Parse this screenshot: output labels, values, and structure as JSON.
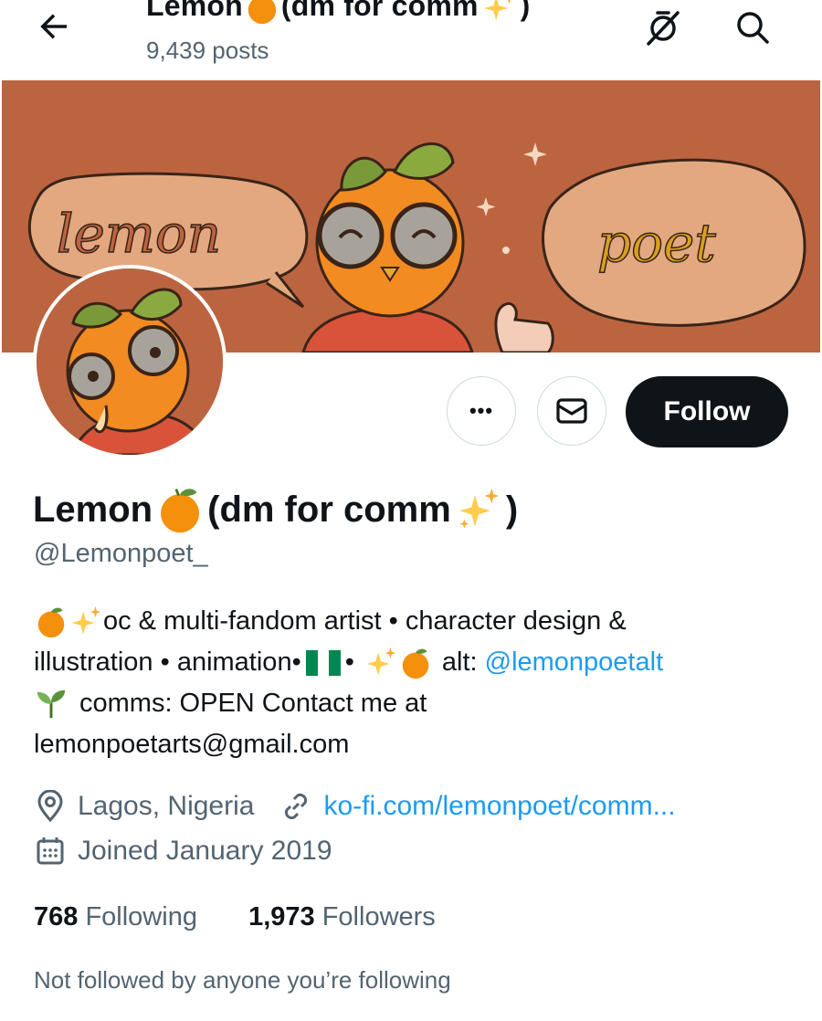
{
  "header": {
    "title_prefix": "Lemon",
    "title_suffix": "(dm for comm",
    "title_close": ")",
    "post_count": "9,439 posts",
    "icons": [
      "back-arrow-icon",
      "notifications-off-icon",
      "search-icon"
    ]
  },
  "banner": {
    "text_left": "lemon",
    "text_right": "poet"
  },
  "actions": {
    "more_label": "•••",
    "follow_label": "Follow"
  },
  "profile": {
    "name_prefix": "Lemon",
    "name_suffix": "(dm for comm",
    "name_close": ")",
    "handle": "@Lemonpoet_"
  },
  "bio": {
    "line1_text": "oc & multi-fandom artist • character design &",
    "line2_text": "illustration • animation•",
    "line2_sep": "•",
    "line2_alt": "alt:",
    "line2_link": "@lemonpoetalt",
    "line3_text": "comms: OPEN Contact me at",
    "line4_text": "lemonpoetarts@gmail.com"
  },
  "meta": {
    "location": "Lagos, Nigeria",
    "website": "ko-fi.com/lemonpoet/comm...",
    "joined": "Joined January 2019"
  },
  "stats": {
    "following_count": "768",
    "following_label": "Following",
    "followers_count": "1,973",
    "followers_label": "Followers"
  },
  "social_context": "Not followed by anyone you’re following",
  "colors": {
    "banner": "#bc6440",
    "link": "#1d9bf0",
    "secondary_text": "#536471",
    "primary_text": "#0f1419"
  }
}
